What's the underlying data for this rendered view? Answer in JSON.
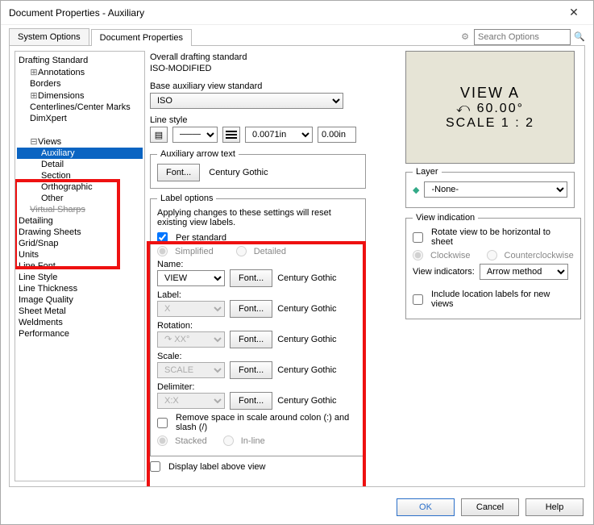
{
  "window": {
    "title": "Document Properties - Auxiliary"
  },
  "tabs": {
    "system": "System Options",
    "document": "Document Properties"
  },
  "search": {
    "placeholder": "Search Options"
  },
  "tree": {
    "root": "Drafting Standard",
    "annotations": "Annotations",
    "borders": "Borders",
    "dimensions": "Dimensions",
    "centerlines": "Centerlines/Center Marks",
    "dimxpert": "DimXpert",
    "views": "Views",
    "auxiliary": "Auxiliary",
    "detail": "Detail",
    "section": "Section",
    "orthographic": "Orthographic",
    "other": "Other",
    "virtualsharps": "Virtual Sharps",
    "detailing": "Detailing",
    "drawingsheets": "Drawing Sheets",
    "gridsnap": "Grid/Snap",
    "units": "Units",
    "linefont": "Line Font",
    "linestyle": "Line Style",
    "linethickness": "Line Thickness",
    "imagequality": "Image Quality",
    "sheetmetal": "Sheet Metal",
    "weldments": "Weldments",
    "performance": "Performance"
  },
  "overall": {
    "label": "Overall drafting standard",
    "value": "ISO-MODIFIED"
  },
  "basestd": {
    "label": "Base auxiliary view standard",
    "value": "ISO"
  },
  "linestyle": {
    "label": "Line style",
    "thickness": "0.0071in",
    "end": "0.00in"
  },
  "arrowtext": {
    "legend": "Auxiliary arrow text",
    "fontbtn": "Font...",
    "fontname": "Century Gothic"
  },
  "labelopts": {
    "legend": "Label options",
    "note": "Applying changes to these settings will reset existing view labels.",
    "perstandard": "Per standard",
    "simplified": "Simplified",
    "detailed": "Detailed",
    "name_lbl": "Name:",
    "name_val": "VIEW",
    "name_font": "Century Gothic",
    "label_lbl": "Label:",
    "label_val": "X",
    "label_font": "Century Gothic",
    "rotation_lbl": "Rotation:",
    "rotation_val": "XX°",
    "rotation_font": "Century Gothic",
    "scale_lbl": "Scale:",
    "scale_val": "SCALE",
    "scale_font": "Century Gothic",
    "delim_lbl": "Delimiter:",
    "delim_val": "X:X",
    "delim_font": "Century Gothic",
    "fontbtn": "Font...",
    "removespace": "Remove space in scale around colon (:) and slash (/)",
    "stacked": "Stacked",
    "inline": "In-line"
  },
  "displayabove": "Display label above view",
  "preview": {
    "line1": "VIEW A",
    "line2": "60.00°",
    "line3": "SCALE 1 : 2"
  },
  "layer": {
    "legend": "Layer",
    "value": "-None-"
  },
  "viewind": {
    "legend": "View indication",
    "rotate": "Rotate view to be horizontal to sheet",
    "cw": "Clockwise",
    "ccw": "Counterclockwise",
    "indicators_lbl": "View indicators:",
    "indicators_val": "Arrow method",
    "include": "Include location labels for new views"
  },
  "footer": {
    "ok": "OK",
    "cancel": "Cancel",
    "help": "Help"
  }
}
